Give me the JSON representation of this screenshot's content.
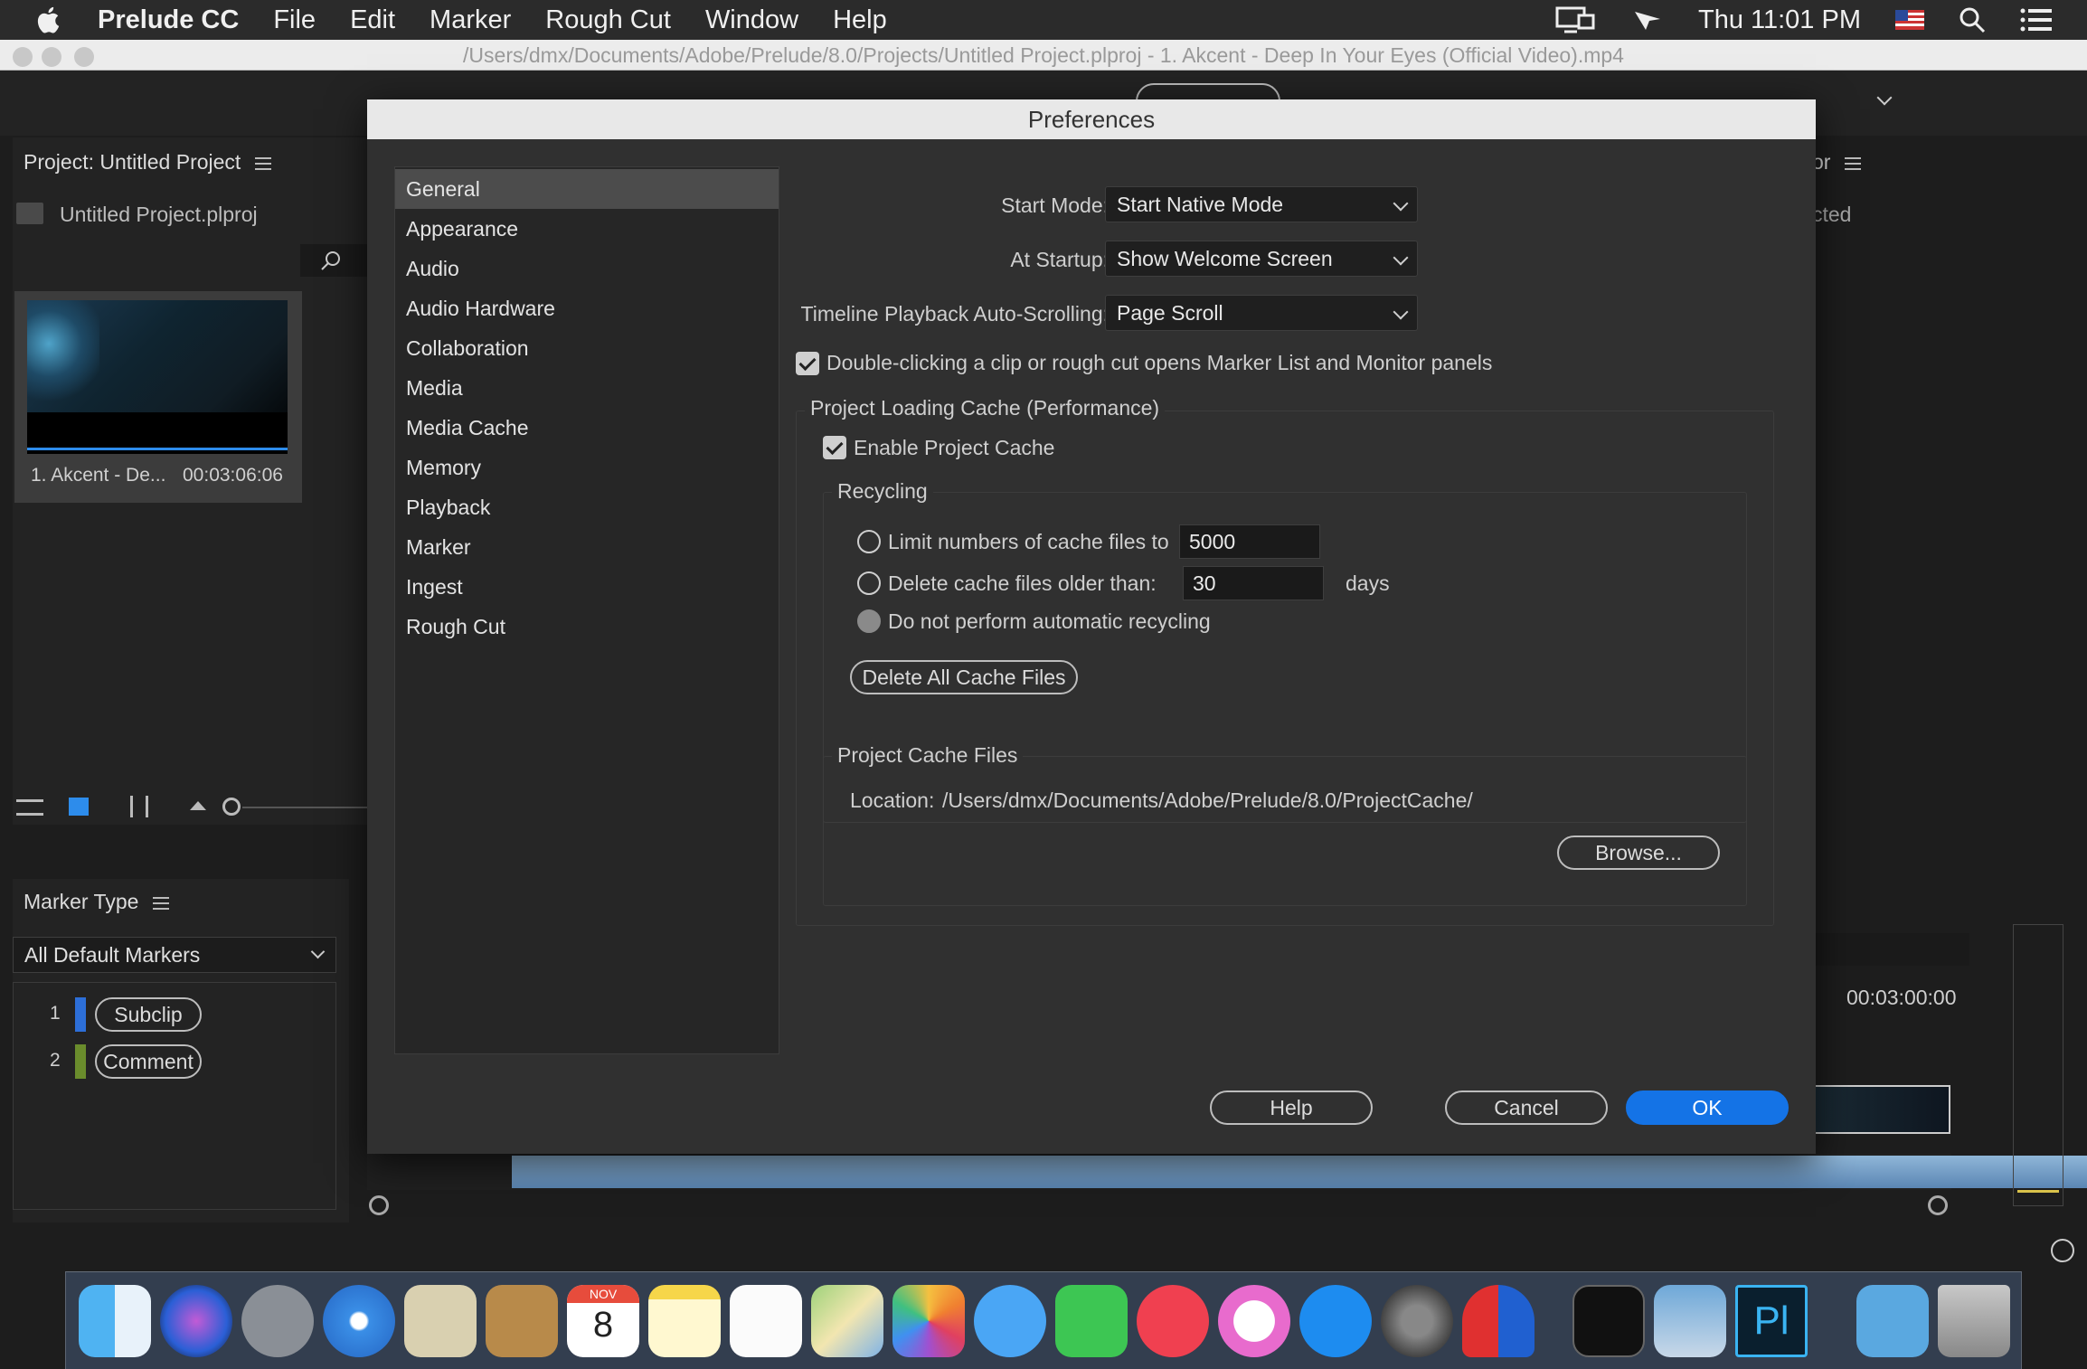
{
  "menubar": {
    "app_name": "Prelude CC",
    "items": [
      "File",
      "Edit",
      "Marker",
      "Rough Cut",
      "Window",
      "Help"
    ],
    "clock": "Thu 11:01 PM"
  },
  "window": {
    "title": "/Users/dmx/Documents/Adobe/Prelude/8.0/Projects/Untitled Project.plproj - 1. Akcent - Deep In Your Eyes (Official Video).mp4"
  },
  "project_panel": {
    "title": "Project: Untitled Project",
    "file": "Untitled Project.plproj",
    "clip_name": "1. Akcent - De...",
    "clip_duration": "00:03:06:06",
    "partial_right_text": "cted",
    "partial_right_hdr": "or"
  },
  "marker_panel": {
    "title": "Marker Type",
    "filter": "All Default Markers",
    "markers": [
      {
        "num": "1",
        "label": "Subclip",
        "color": "#2d6fd8"
      },
      {
        "num": "2",
        "label": "Comment",
        "color": "#6a8c2c"
      }
    ]
  },
  "timeline": {
    "timecode": "00:03:00:00"
  },
  "dialog": {
    "title": "Preferences",
    "categories": [
      "General",
      "Appearance",
      "Audio",
      "Audio Hardware",
      "Collaboration",
      "Media",
      "Media Cache",
      "Memory",
      "Playback",
      "Marker",
      "Ingest",
      "Rough Cut"
    ],
    "start_mode_label": "Start Mode:",
    "start_mode_value": "Start Native Mode",
    "at_startup_label": "At Startup:",
    "at_startup_value": "Show Welcome Screen",
    "autoscroll_label": "Timeline Playback Auto-Scrolling:",
    "autoscroll_value": "Page Scroll",
    "double_click_label": "Double-clicking a clip or rough cut opens Marker List and Monitor panels",
    "cache_group_title": "Project Loading Cache (Performance)",
    "enable_cache_label": "Enable Project Cache",
    "recycling_title": "Recycling",
    "limit_label": "Limit numbers of cache files to",
    "limit_value": "5000",
    "delete_older_label": "Delete cache files older than:",
    "delete_older_value": "30",
    "days_label": "days",
    "no_recycle_label": "Do not perform automatic recycling",
    "delete_all_button": "Delete All Cache Files",
    "cache_files_title": "Project Cache Files",
    "location_label": "Location:",
    "location_value": "/Users/dmx/Documents/Adobe/Prelude/8.0/ProjectCache/",
    "browse_button": "Browse...",
    "help_button": "Help",
    "cancel_button": "Cancel",
    "ok_button": "OK",
    "colors": {
      "primary": "#1473e6"
    }
  },
  "dock": {
    "calendar_month": "NOV",
    "calendar_day": "8",
    "icons": [
      "finder",
      "siri",
      "launchpad",
      "safari",
      "mail-eagle",
      "contacts",
      "calendar",
      "notes",
      "reminders",
      "maps",
      "photos",
      "messages",
      "facetime",
      "news",
      "itunes",
      "app-store",
      "system-preferences",
      "magnet",
      "terminal",
      "preview",
      "prelude",
      "downloads",
      "trash"
    ]
  }
}
